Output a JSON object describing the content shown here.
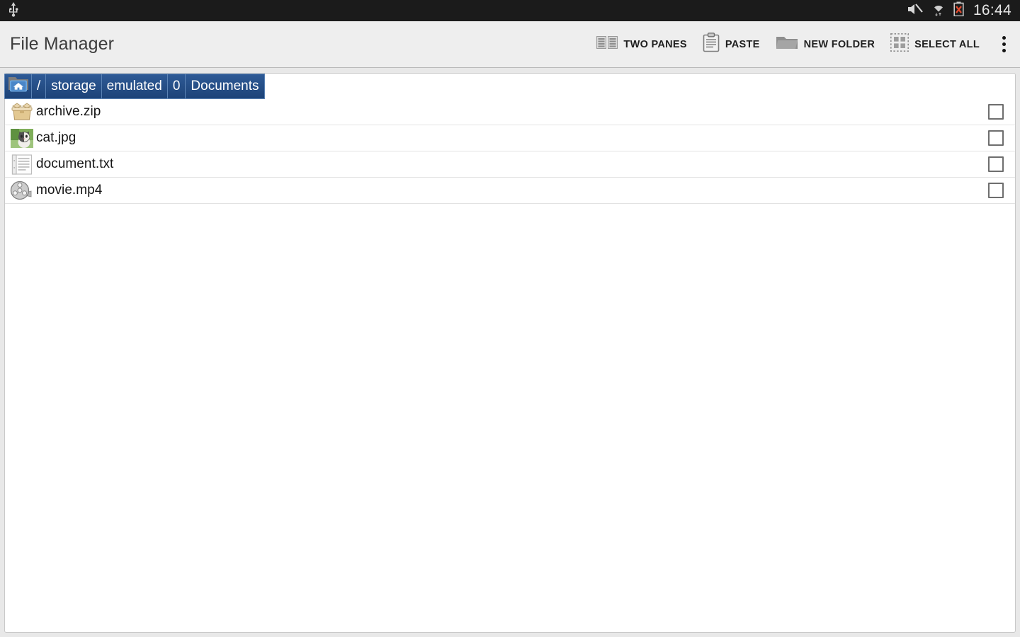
{
  "status_bar": {
    "left_icons": [
      {
        "name": "usb-icon",
        "glyph": "usb"
      }
    ],
    "right_icons": [
      {
        "name": "volume-mute-icon",
        "glyph": "mute"
      },
      {
        "name": "wifi-icon",
        "glyph": "wifi"
      },
      {
        "name": "battery-missing-icon",
        "glyph": "battery-x"
      }
    ],
    "clock": "16:44"
  },
  "action_bar": {
    "title": "File Manager",
    "items": [
      {
        "label": "TWO PANES",
        "icon": "two-panes-icon"
      },
      {
        "label": "PASTE",
        "icon": "clipboard-paste-icon"
      },
      {
        "label": "NEW FOLDER",
        "icon": "new-folder-icon"
      },
      {
        "label": "SELECT ALL",
        "icon": "select-all-icon"
      }
    ],
    "overflow_label": "More options"
  },
  "breadcrumb": {
    "home_icon": "home-folder-icon",
    "segments": [
      {
        "label": "/"
      },
      {
        "label": "storage"
      },
      {
        "label": "emulated"
      },
      {
        "label": "0"
      },
      {
        "label": "Documents"
      }
    ]
  },
  "file_list": {
    "rows": [
      {
        "name": "archive.zip",
        "icon": "archive-box-icon",
        "checked": false
      },
      {
        "name": "cat.jpg",
        "icon": "image-thumbnail-icon",
        "checked": false
      },
      {
        "name": "document.txt",
        "icon": "text-document-icon",
        "checked": false
      },
      {
        "name": "movie.mp4",
        "icon": "film-reel-icon",
        "checked": false
      }
    ]
  },
  "colors": {
    "status_bar_bg": "#1b1b1b",
    "action_bar_bg": "#eeeeee",
    "breadcrumb_blue": "#1d4378",
    "breadcrumb_home_blue": "#4a86c8",
    "page_bg": "#e8e8e8",
    "panel_bg": "#ffffff"
  }
}
